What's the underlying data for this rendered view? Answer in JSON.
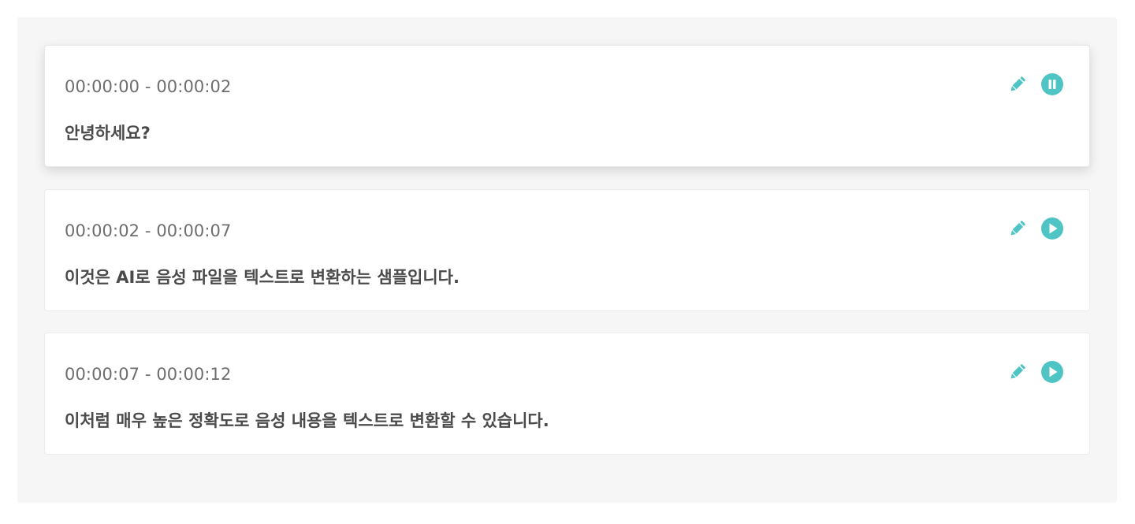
{
  "accent_color": "#4fc4c4",
  "segments": [
    {
      "timecode": "00:00:00 - 00:00:02",
      "text": "안녕하세요?",
      "state": "playing",
      "edit_icon": "pencil-icon",
      "playback_icon": "pause-icon"
    },
    {
      "timecode": "00:00:02 - 00:00:07",
      "text": "이것은 AI로 음성 파일을 텍스트로 변환하는 샘플입니다.",
      "state": "stopped",
      "edit_icon": "pencil-icon",
      "playback_icon": "play-icon"
    },
    {
      "timecode": "00:00:07 - 00:00:12",
      "text": "이처럼 매우 높은 정확도로 음성 내용을 텍스트로 변환할 수 있습니다.",
      "state": "stopped",
      "edit_icon": "pencil-icon",
      "playback_icon": "play-icon"
    }
  ]
}
